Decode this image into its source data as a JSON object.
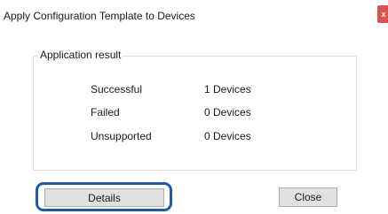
{
  "window": {
    "title": "Apply Configuration Template to Devices",
    "close_glyph": "x"
  },
  "group": {
    "legend": "Application result",
    "rows": [
      {
        "label": "Successful",
        "value": "1 Devices"
      },
      {
        "label": "Failed",
        "value": "0 Devices"
      },
      {
        "label": "Unsupported",
        "value": "0 Devices"
      }
    ]
  },
  "buttons": {
    "details_label": "Details",
    "close_label": "Close"
  },
  "colors": {
    "highlight": "#1e5aa8",
    "close_button_bg": "#d9534f"
  }
}
